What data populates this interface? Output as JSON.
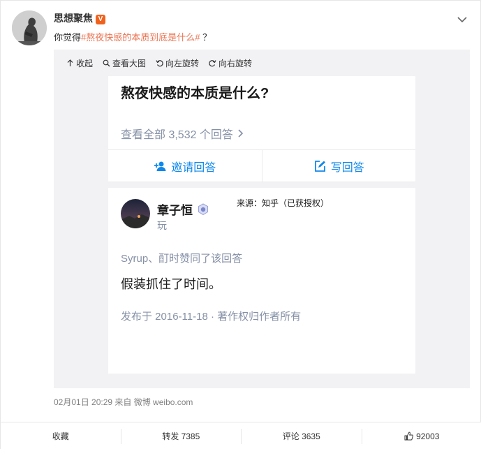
{
  "post": {
    "username": "思想聚焦",
    "verified_badge": "V",
    "text_prefix": "你觉得",
    "hashtag": "#熬夜快感的本质到底是什么#",
    "text_suffix": " ？",
    "meta": "02月01日 20:29  来自 微博 weibo.com"
  },
  "toolbar": {
    "collapse": "收起",
    "view_large": "查看大图",
    "rotate_left": "向左旋转",
    "rotate_right": "向右旋转"
  },
  "zhihu": {
    "question_title": "熬夜快感的本质是什么?",
    "view_all": "查看全部 3,532 个回答",
    "invite": "邀请回答",
    "write": "写回答",
    "answerer_name": "章子恒",
    "answerer_bio": "玩",
    "source_note": "来源：知乎（已获授权）",
    "voters": "Syrup、酊时赞同了该回答",
    "answer_text": "假装抓住了时间。",
    "answer_meta": "发布于 2016-11-18 · 著作权归作者所有"
  },
  "footer": {
    "favorite": "收藏",
    "repost": "转发 7385",
    "comment": "评论 3635",
    "likes": "92003"
  },
  "colors": {
    "hashtag": "#eb7350",
    "zhihu_blue": "#0f88eb",
    "muted": "#8590a6",
    "badge": "#f0611c"
  }
}
